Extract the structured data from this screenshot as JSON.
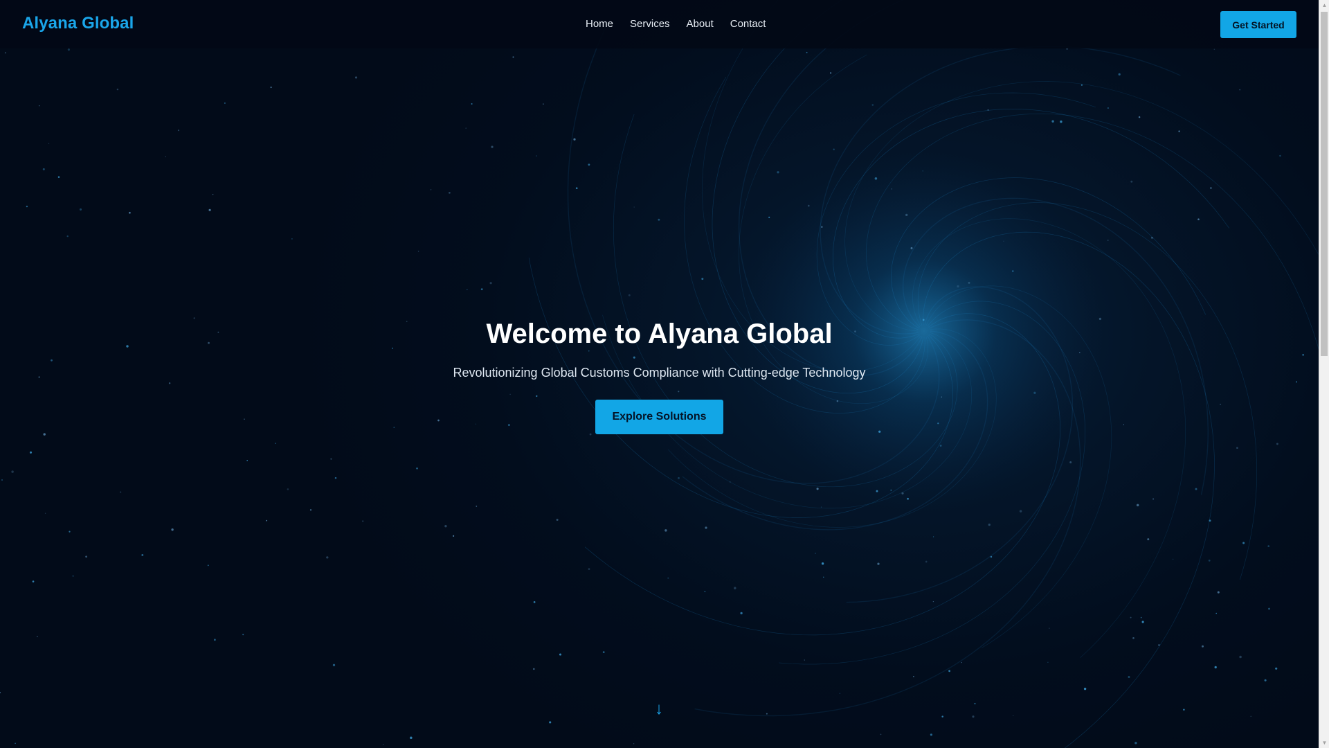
{
  "header": {
    "brand": "Alyana Global",
    "nav": [
      {
        "label": "Home"
      },
      {
        "label": "Services"
      },
      {
        "label": "About"
      },
      {
        "label": "Contact"
      }
    ],
    "cta_label": "Get Started"
  },
  "hero": {
    "title": "Welcome to Alyana Global",
    "subtitle": "Revolutionizing Global Customs Compliance with Cutting-edge Technology",
    "button_label": "Explore Solutions",
    "scroll_glyph": "↓"
  },
  "scrollbar": {
    "up_glyph": "▲",
    "down_glyph": "▼"
  },
  "colors": {
    "accent": "#12a6e6",
    "brand_text": "#1aa6ea",
    "background": "#020b1a",
    "swirl": "#1e8fd6"
  }
}
